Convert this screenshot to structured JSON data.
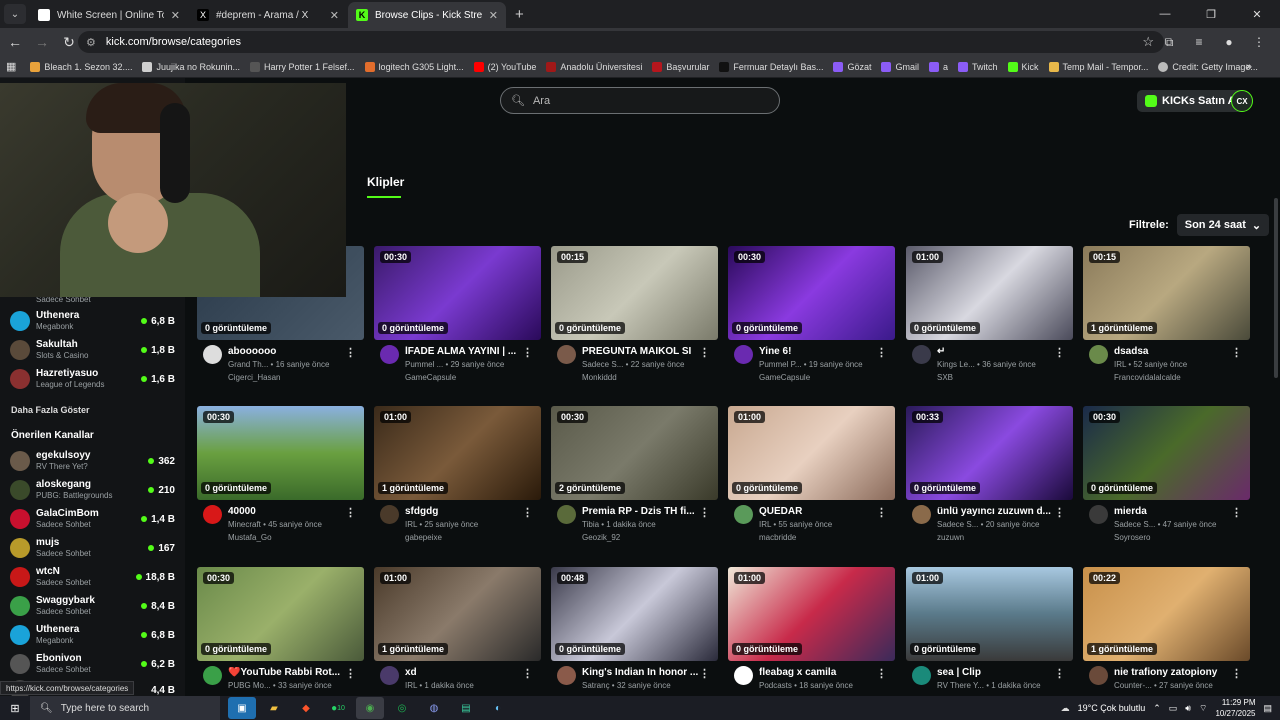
{
  "browser": {
    "tabs": [
      {
        "title": "White Screen | Online Tool",
        "fav_color": "#ffffff",
        "active": false
      },
      {
        "title": "#deprem - Arama / X",
        "fav_color": "#000000",
        "active": false
      },
      {
        "title": "Browse Clips - Kick Streaming",
        "fav_color": "#53fc18",
        "active": true
      }
    ],
    "url": "kick.com/browse/categories",
    "bookmarks": [
      {
        "label": "Bleach 1. Sezon 32....",
        "color": "#e9a23b"
      },
      {
        "label": "Juujika no Rokunin...",
        "color": "#cfcfcf"
      },
      {
        "label": "Harry Potter 1 Felsef...",
        "color": "#333333"
      },
      {
        "label": "logitech G305 Light...",
        "color": "#e26d2c"
      },
      {
        "label": "(2) YouTube",
        "color": "#ff0000"
      },
      {
        "label": "Anadolu Üniversitesi",
        "color": "#a01818"
      },
      {
        "label": "Başvurular",
        "color": "#b5161d"
      },
      {
        "label": "Fermuar Detaylı Bas...",
        "color": "#1a1a1a"
      },
      {
        "label": "Gözat",
        "color": "#8b5cf6"
      },
      {
        "label": "Gmail",
        "color": "#8b5cf6"
      },
      {
        "label": "a",
        "color": "#8b5cf6"
      },
      {
        "label": "Twitch",
        "color": "#8b5cf6"
      },
      {
        "label": "Kick",
        "color": "#53fc18"
      },
      {
        "label": "Temp Mail - Tempor...",
        "color": "#e8b84a"
      },
      {
        "label": "Credit: Getty Image...",
        "color": "#bbbbbb"
      }
    ],
    "status_url": "https://kick.com/browse/categories"
  },
  "header": {
    "search_placeholder": "Ara",
    "kicks_button": "KICKs Satın Al",
    "user_initials": "CX"
  },
  "content": {
    "tab_label": "Klipler",
    "filter_label": "Filtrele:",
    "filter_value": "Son 24 saat"
  },
  "sidebar": {
    "partial_category": "Sadece Sohbet",
    "channels": [
      {
        "name": "Uthenera",
        "category": "Megabonk",
        "viewers": "6,8 B",
        "color": "#1aa3d9"
      },
      {
        "name": "Sakultah",
        "category": "Slots & Casino",
        "viewers": "1,8 B",
        "color": "#5a4a3a"
      },
      {
        "name": "Hazretiyasuo",
        "category": "League of Legends",
        "viewers": "1,6 B",
        "color": "#8a3030"
      }
    ],
    "show_more": "Daha Fazla Göster",
    "recommended_heading": "Önerilen Kanallar",
    "recommended": [
      {
        "name": "egekulsoyy",
        "category": "RV There Yet?",
        "viewers": "362",
        "color": "#6a5a4a"
      },
      {
        "name": "aloskegang",
        "category": "PUBG: Battlegrounds",
        "viewers": "210",
        "color": "#3a4a2a"
      },
      {
        "name": "GalaCimBom",
        "category": "Sadece Sohbet",
        "viewers": "1,4 B",
        "color": "#c8102e"
      },
      {
        "name": "mujs",
        "category": "Sadece Sohbet",
        "viewers": "167",
        "color": "#b89a2a"
      },
      {
        "name": "wtcN",
        "category": "Sadece Sohbet",
        "viewers": "18,8 B",
        "color": "#c81818"
      },
      {
        "name": "Swaggybark",
        "category": "Sadece Sohbet",
        "viewers": "8,4 B",
        "color": "#3aa048"
      },
      {
        "name": "Uthenera",
        "category": "Megabonk",
        "viewers": "6,8 B",
        "color": "#1aa3d9"
      },
      {
        "name": "Ebonivon",
        "category": "Sadece Sohbet",
        "viewers": "6,2 B",
        "color": "#555555"
      },
      {
        "name": "",
        "category": "",
        "viewers": "4,4 B",
        "color": "#444444"
      }
    ]
  },
  "clips": [
    {
      "duration": "",
      "views": "0 görüntüleme",
      "title": "aboooooo",
      "category": "Grand Th...",
      "time": "16 saniye önce",
      "channel": "Cigerci_Hasan",
      "bg": "linear-gradient(135deg,#2a3a4a,#4a5a6a)",
      "av": "#dddddd"
    },
    {
      "duration": "00:30",
      "views": "0 görüntüleme",
      "title": "İFADE ALMA YAYINI | ...",
      "category": "Pummel ...",
      "time": "29 saniye önce",
      "channel": "GameCapsule",
      "bg": "linear-gradient(135deg,#3a1a6a,#7a3ad0,#2a0a5a)",
      "av": "#6a2ab0"
    },
    {
      "duration": "00:15",
      "views": "0 görüntüleme",
      "title": "PREGUNTA MAIKOL SI",
      "category": "Sadece S...",
      "time": "22 saniye önce",
      "channel": "Monkiddd",
      "bg": "linear-gradient(135deg,#9a9a8a,#c8c8b8,#7a7a6a)",
      "av": "#7a5a4a"
    },
    {
      "duration": "00:30",
      "views": "0 görüntüleme",
      "title": "Yine 6!",
      "category": "Pummel P...",
      "time": "19 saniye önce",
      "channel": "GameCapsule",
      "bg": "linear-gradient(135deg,#2a0a5a,#8a3ae0,#3a1a8a)",
      "av": "#6a2ab0"
    },
    {
      "duration": "01:00",
      "views": "0 görüntüleme",
      "title": "↵",
      "category": "Kings Le...",
      "time": "36 saniye önce",
      "channel": "SXB",
      "bg": "linear-gradient(135deg,#5a5a6a,#d8d8e0,#4a4a5a)",
      "av": "#3a3a4a"
    },
    {
      "duration": "00:15",
      "views": "1 görüntüleme",
      "title": "dsadsa",
      "category": "IRL",
      "time": "52 saniye önce",
      "channel": "Francovidalalcalde",
      "bg": "linear-gradient(135deg,#8a7a5a,#b8a880,#4a4a3a)",
      "av": "#6a8a4a"
    },
    {
      "duration": "00:30",
      "views": "0 görüntüleme",
      "title": "40000",
      "category": "Minecraft",
      "time": "45 saniye önce",
      "channel": "Mustafa_Go",
      "bg": "linear-gradient(180deg,#8ab0e0,#6aa040,#3a6a2a)",
      "av": "#d81818"
    },
    {
      "duration": "01:00",
      "views": "1 görüntüleme",
      "title": "sfdgdg",
      "category": "IRL",
      "time": "25 saniye önce",
      "channel": "gabepeixe",
      "bg": "linear-gradient(135deg,#3a2a1a,#7a5a3a,#2a1a0a)",
      "av": "#4a3a2a"
    },
    {
      "duration": "00:30",
      "views": "2 görüntüleme",
      "title": "Premia RP - Dzis TH fi...",
      "category": "Tibia",
      "time": "1 dakika önce",
      "channel": "Geozik_92",
      "bg": "linear-gradient(135deg,#5a5a4a,#7a7a6a,#3a3a2a)",
      "av": "#5a6a3a"
    },
    {
      "duration": "01:00",
      "views": "0 görüntüleme",
      "title": "QUEDAR",
      "category": "IRL",
      "time": "55 saniye önce",
      "channel": "macbridde",
      "bg": "linear-gradient(135deg,#c8a890,#e8d0c0,#8a6a5a)",
      "av": "#5a9a5a"
    },
    {
      "duration": "00:33",
      "views": "0 görüntüleme",
      "title": "ünlü yayıncı zuzuwn d...",
      "category": "Sadece S...",
      "time": "20 saniye önce",
      "channel": "zuzuwn",
      "bg": "linear-gradient(135deg,#2a1a5a,#8a4ae0,#1a0a3a)",
      "av": "#8a6a4a"
    },
    {
      "duration": "00:30",
      "views": "0 görüntüleme",
      "title": "mierda",
      "category": "Sadece S...",
      "time": "47 saniye önce",
      "channel": "Soyrosero",
      "bg": "linear-gradient(135deg,#1a2a4a,#4a6a2a,#6a2a6a)",
      "av": "#3a3a3a"
    },
    {
      "duration": "00:30",
      "views": "0 görüntüleme",
      "title": "❤️YouTube Rabbi Rot...",
      "category": "PUBG Mo...",
      "time": "33 saniye önce",
      "channel": "",
      "bg": "linear-gradient(135deg,#6a8a4a,#9ab06a,#4a5a3a)",
      "av": "#3aa048"
    },
    {
      "duration": "01:00",
      "views": "1 görüntüleme",
      "title": "xd",
      "category": "IRL",
      "time": "1 dakika önce",
      "channel": "",
      "bg": "linear-gradient(135deg,#4a3a2a,#8a7a6a,#2a2a2a)",
      "av": "#4a3a6a"
    },
    {
      "duration": "00:48",
      "views": "0 görüntüleme",
      "title": "King's Indian In honor ...",
      "category": "Satranç",
      "time": "32 saniye önce",
      "channel": "",
      "bg": "linear-gradient(135deg,#3a3a4a,#c8c8d8,#2a2a3a)",
      "av": "#8a5a4a"
    },
    {
      "duration": "01:00",
      "views": "0 görüntüleme",
      "title": "fleabag x camila",
      "category": "Podcasts",
      "time": "18 saniye önce",
      "channel": "",
      "bg": "linear-gradient(135deg,#f0e8d8,#c82a4a,#3a2a5a)",
      "av": "#ffffff"
    },
    {
      "duration": "01:00",
      "views": "0 görüntüleme",
      "title": "sea | Clip",
      "category": "RV There Y...",
      "time": "1 dakika önce",
      "channel": "",
      "bg": "linear-gradient(180deg,#a8c8e0,#5a7a8a,#3a3a3a)",
      "av": "#1a8a7a"
    },
    {
      "duration": "00:22",
      "views": "1 görüntüleme",
      "title": "nie trafiony zatopiony",
      "category": "Counter-...",
      "time": "27 saniye önce",
      "channel": "",
      "bg": "linear-gradient(135deg,#c8904a,#e0b070,#6a4a2a)",
      "av": "#6a4a3a"
    }
  ],
  "taskbar": {
    "search_placeholder": "Type here to search",
    "weather": "19°C  Çok bulutlu",
    "time": "11:29 PM",
    "date": "10/27/2025",
    "whatsapp_badge": "10"
  }
}
